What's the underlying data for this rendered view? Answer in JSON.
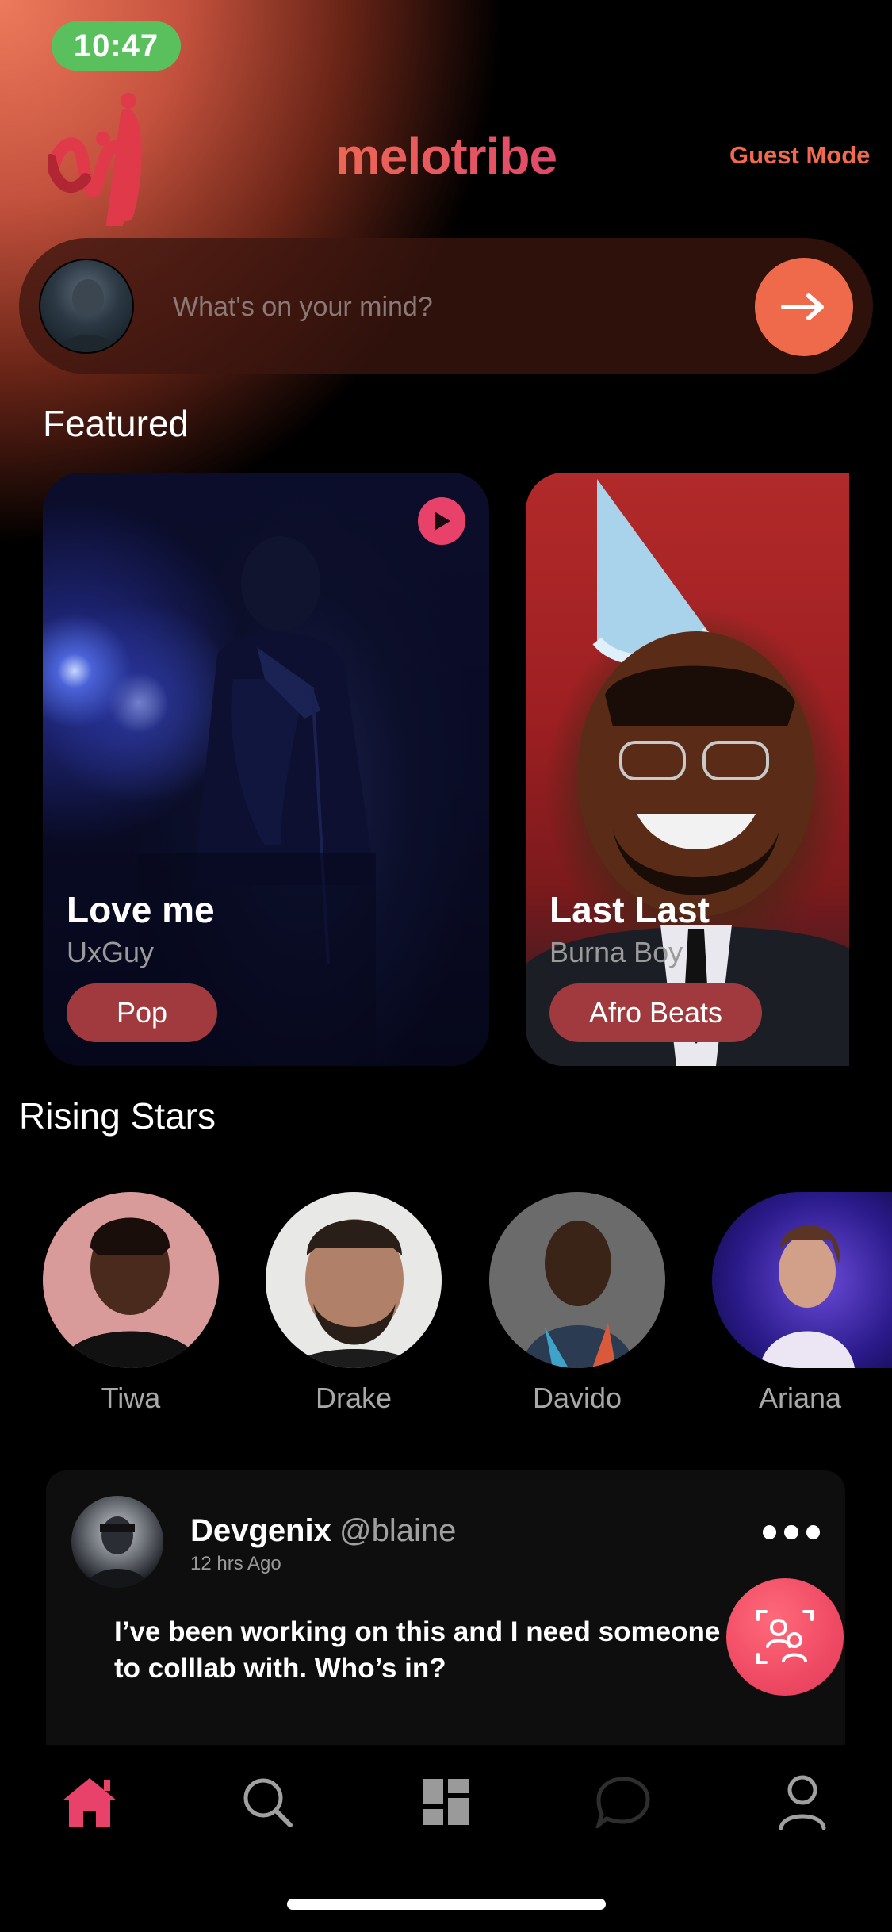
{
  "status_bar": {
    "time": "10:47"
  },
  "header": {
    "brand": "melotribe",
    "guest_mode_label": "Guest Mode",
    "brand_colors": [
      "#f0714e",
      "#e0496a"
    ]
  },
  "composer": {
    "placeholder": "What's on your mind?",
    "send_icon": "arrow-right-icon"
  },
  "featured": {
    "title": "Featured",
    "cards": [
      {
        "title": "Love me",
        "artist": "UxGuy",
        "genre": "Pop"
      },
      {
        "title": "Last Last",
        "artist": "Burna Boy",
        "genre": "Afro Beats"
      }
    ]
  },
  "rising_stars": {
    "title": "Rising Stars",
    "items": [
      {
        "name": "Tiwa"
      },
      {
        "name": "Drake"
      },
      {
        "name": "Davido"
      },
      {
        "name": "Ariana"
      }
    ]
  },
  "post": {
    "author": "Devgenix",
    "handle": "@blaine",
    "time": "12 hrs Ago",
    "text": "I’ve been working on this and I need someone to colllab with. Who’s in?"
  },
  "tabbar": {
    "items": [
      {
        "icon": "home-icon",
        "active": true
      },
      {
        "icon": "search-icon",
        "active": false
      },
      {
        "icon": "grid-icon",
        "active": false
      },
      {
        "icon": "chat-icon",
        "active": false
      },
      {
        "icon": "profile-icon",
        "active": false
      }
    ]
  },
  "colors": {
    "accent": "#ee6a4a",
    "pink": "#e8426a",
    "chip": "#a03a3e",
    "status_green": "#5ac05e"
  }
}
